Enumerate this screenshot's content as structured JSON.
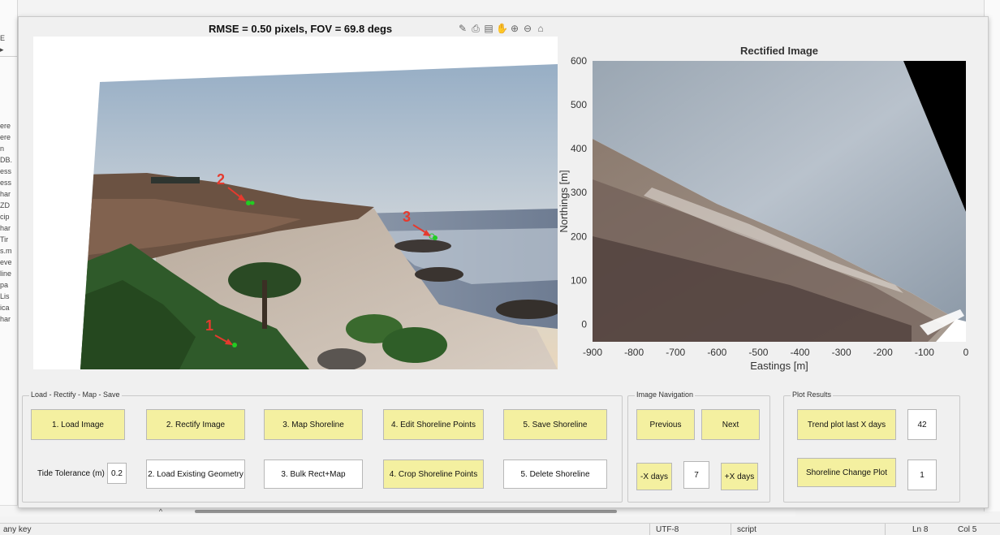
{
  "ide": {
    "left_fragments": [
      "ere",
      "ere",
      "n",
      "DB.",
      "ess",
      "ess",
      "har",
      "ZD",
      "cip",
      "har",
      "Tir",
      "s.m",
      "eve",
      "line",
      "pa",
      "Lis",
      "ica",
      "har"
    ],
    "status_left": "any key",
    "status_encoding": "UTF-8",
    "status_type": "script",
    "status_ln": "Ln  8",
    "status_col": "Col  5"
  },
  "figure": {
    "image_title": "RMSE = 0.50 pixels, FOV = 69.8 degs",
    "rectified_title": "Rectified Image",
    "toolbar": [
      "brush-icon",
      "data-tip-icon",
      "legend-icon",
      "pan-hand-icon",
      "zoom-in-icon",
      "zoom-out-icon",
      "home-icon"
    ],
    "gcp_labels": [
      "1",
      "2",
      "3"
    ]
  },
  "chart_data": {
    "type": "image",
    "title": "Rectified Image",
    "xlabel": "Eastings [m]",
    "ylabel": "Northings [m]",
    "xlim": [
      -900,
      0
    ],
    "ylim": [
      -40,
      600
    ],
    "xticks": [
      -900,
      -800,
      -700,
      -600,
      -500,
      -400,
      -300,
      -200,
      -100,
      0
    ],
    "yticks": [
      0,
      100,
      200,
      300,
      400,
      500,
      600
    ]
  },
  "panels": {
    "lrms": {
      "title": "Load - Rectify - Map - Save",
      "load_image": "1. Load Image",
      "rectify_image": "2. Rectify Image",
      "map_shoreline": "3. Map Shoreline",
      "edit_points": "4. Edit Shoreline Points",
      "save_shoreline": "5. Save Shoreline",
      "tide_label": "Tide Tolerance (m)",
      "tide_value": "0.2",
      "load_geometry": "2. Load Existing Geometry",
      "bulk_rect": "3. Bulk Rect+Map",
      "crop_points": "4. Crop Shoreline Points",
      "delete_shoreline": "5. Delete Shoreline"
    },
    "nav": {
      "title": "Image Navigation",
      "previous": "Previous",
      "next": "Next",
      "minus_days": "-X days",
      "days_value": "7",
      "plus_days": "+X days"
    },
    "plot": {
      "title": "Plot Results",
      "trend_plot": "Trend plot last X days",
      "trend_value": "42",
      "change_plot": "Shoreline Change Plot",
      "change_value": "1"
    }
  },
  "colors": {
    "button_yellow": "#f4f0a0",
    "gcp_green": "#22cc22",
    "annotation_red": "#e53a2e"
  }
}
